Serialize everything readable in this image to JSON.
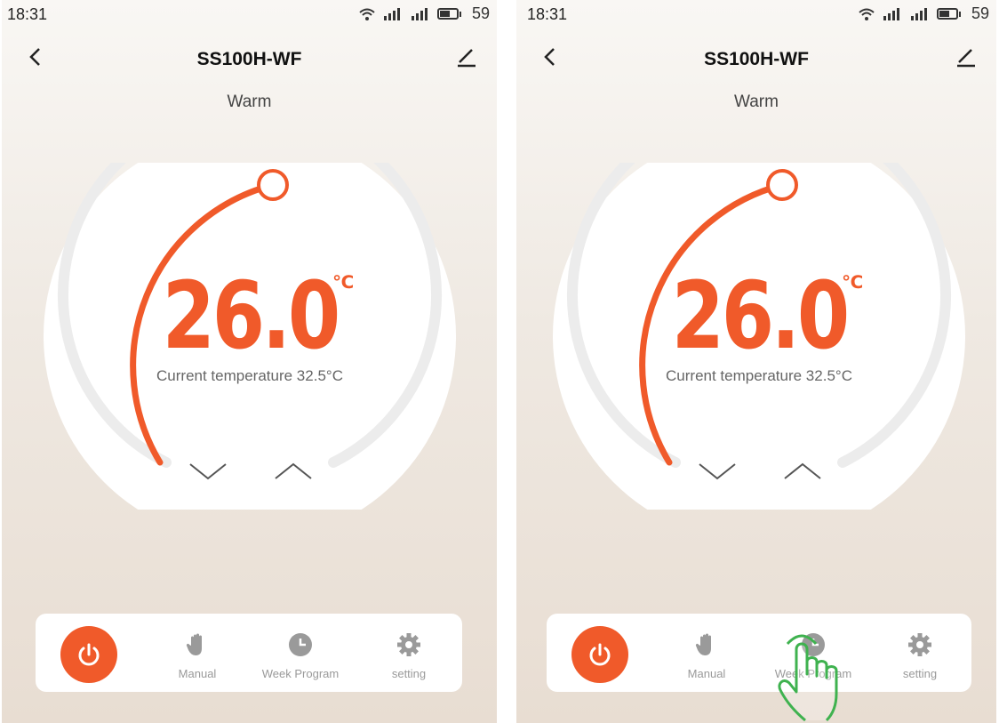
{
  "colors": {
    "accent": "#f05a2a",
    "track": "#ececec",
    "tab_icon": "#9a9a9a",
    "hand_outline": "#3fb24f"
  },
  "status_bar": {
    "time": "18:31",
    "battery": "59",
    "icons": [
      "wifi-icon",
      "signal-icon",
      "signal-icon",
      "battery-icon"
    ]
  },
  "header": {
    "title": "SS100H-WF",
    "back_icon": "chevron-left-icon",
    "edit_icon": "edit-icon"
  },
  "mode": "Warm",
  "thermostat": {
    "setpoint": "26.0",
    "unit": "℃",
    "current_label": "Current temperature 32.5°C"
  },
  "tabs": [
    {
      "label": "",
      "icon": "power-icon"
    },
    {
      "label": "Manual",
      "icon": "hand-icon"
    },
    {
      "label": "Week Program",
      "icon": "clock-icon"
    },
    {
      "label": "setting",
      "icon": "gear-icon"
    }
  ]
}
